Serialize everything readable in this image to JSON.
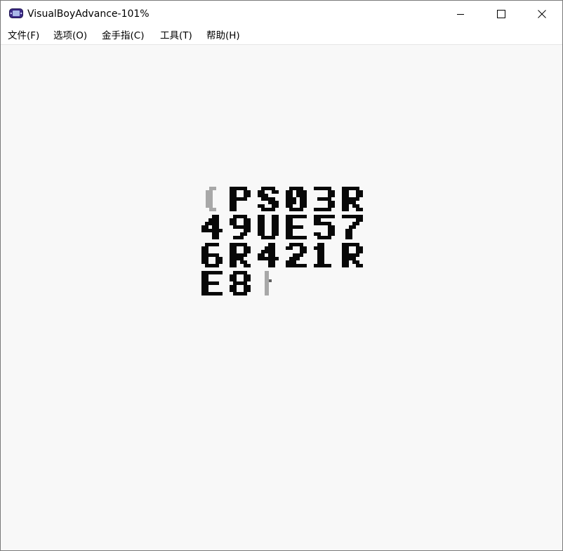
{
  "window": {
    "title": "VisualBoyAdvance-101%",
    "app_icon": "gba-icon",
    "controls": {
      "minimize_icon": "minimize-icon",
      "maximize_icon": "maximize-icon",
      "close_icon": "close-icon"
    }
  },
  "menubar": {
    "items": [
      {
        "label": "文件(F)"
      },
      {
        "label": "选项(O)"
      },
      {
        "label": "金手指(C)"
      },
      {
        "label": "工具(T)"
      },
      {
        "label": "帮助(H)"
      }
    ]
  },
  "game_screen": {
    "code_lines": [
      "PS03R",
      "49UE57",
      "6R421R",
      "E8"
    ],
    "left_bracket": "[",
    "cursor_icon": "text-cursor-icon",
    "colors": {
      "background": "#f8f8f8",
      "text": "#080808",
      "muted": "#a8a8a8"
    }
  }
}
